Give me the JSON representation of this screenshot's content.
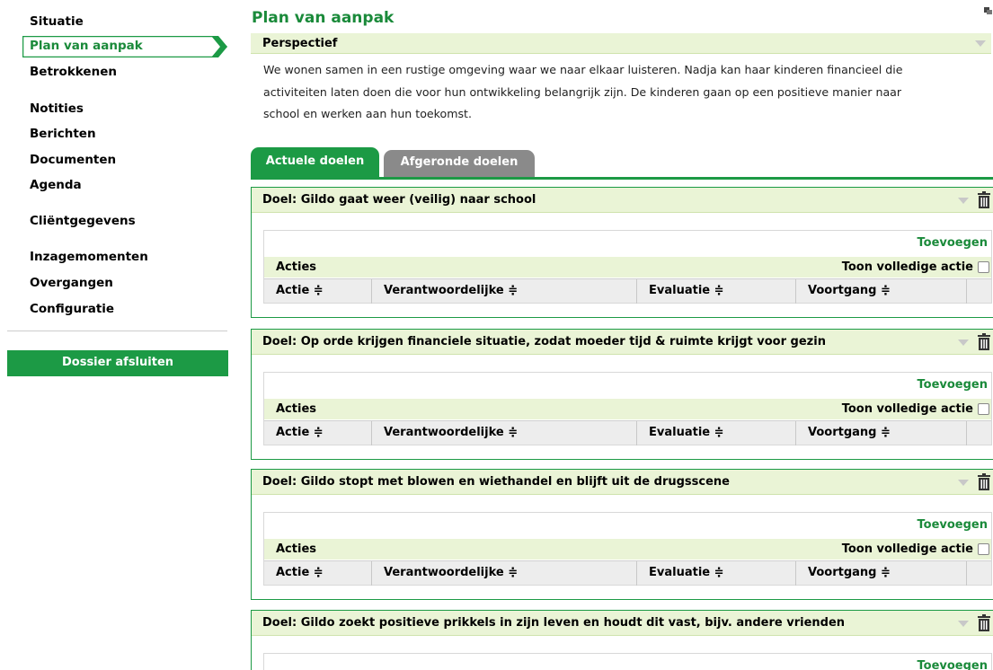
{
  "sidebar": {
    "items": [
      {
        "label": "Situatie"
      },
      {
        "label": "Plan van aanpak",
        "active": true
      },
      {
        "label": "Betrokkenen"
      },
      {
        "label": "Notities"
      },
      {
        "label": "Berichten"
      },
      {
        "label": "Documenten"
      },
      {
        "label": "Agenda"
      },
      {
        "label": "Cliëntgegevens"
      },
      {
        "label": "Inzagemomenten"
      },
      {
        "label": "Overgangen"
      },
      {
        "label": "Configuratie"
      }
    ],
    "close_button": "Dossier afsluiten"
  },
  "main": {
    "title": "Plan van aanpak",
    "perspective": {
      "title": "Perspectief",
      "lines": [
        "We wonen samen in een rustige omgeving waar we naar elkaar luisteren. Nadja kan haar kinderen financieel die",
        "activiteiten laten doen die voor hun ontwikkeling belangrijk zijn. De kinderen gaan op een positieve manier naar",
        "school en werken aan hun toekomst."
      ]
    },
    "tabs": [
      {
        "label": "Actuele doelen",
        "active": true
      },
      {
        "label": "Afgeronde doelen"
      }
    ],
    "goals": [
      {
        "title": "Doel: Gildo gaat weer (veilig) naar school"
      },
      {
        "title": "Doel: Op orde krijgen financiele situatie, zodat moeder tijd & ruimte krijgt voor gezin"
      },
      {
        "title": "Doel: Gildo stopt met blowen en wiethandel en blijft uit de drugsscene"
      },
      {
        "title": "Doel: Gildo zoekt positieve prikkels in zijn leven en houdt dit vast, bijv. andere vrienden"
      }
    ],
    "goal_panel": {
      "add_label": "Toevoegen",
      "actions_label": "Acties",
      "show_full_label": "Toon volledige actie",
      "columns": [
        "Actie ≑",
        "Verantwoordelijke ≑",
        "Evaluatie ≑",
        "Voortgang ≑"
      ]
    }
  },
  "colors": {
    "brand_green": "#1c9a45",
    "light_green": "#eaf4d6",
    "tab_gray": "#8a8a8a"
  }
}
